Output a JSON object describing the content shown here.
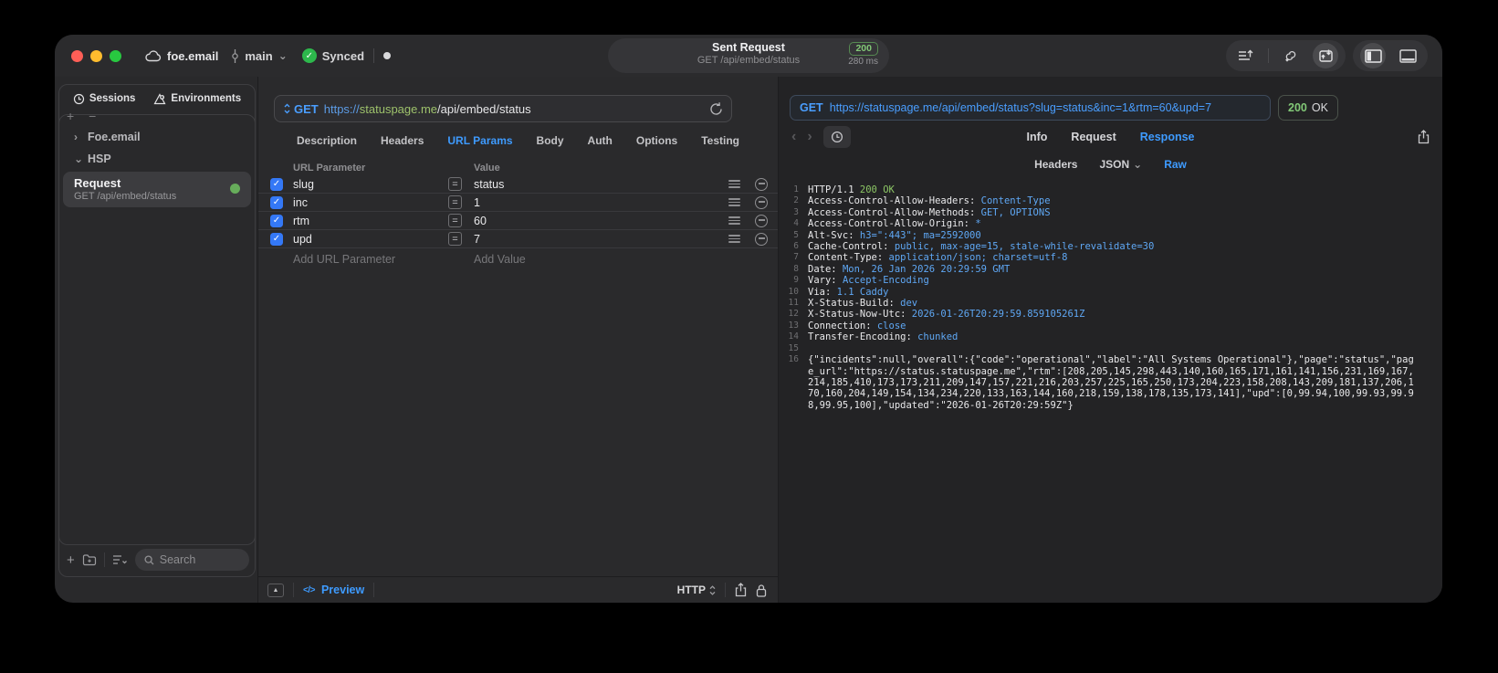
{
  "titlebar": {
    "project": "foe.email",
    "branch": "main",
    "sync_status": "Synced",
    "pill": {
      "title": "Sent Request",
      "subtitle": "GET /api/embed/status",
      "status_code": "200",
      "duration": "280 ms"
    }
  },
  "sidebar": {
    "tabs": [
      {
        "label": "Sessions"
      },
      {
        "label": "Environments"
      }
    ],
    "tree": [
      {
        "label": "Foe.email"
      },
      {
        "label": "HSP"
      }
    ],
    "request_item": {
      "title": "Request",
      "subtitle": "GET /api/embed/status"
    },
    "search_placeholder": "Search"
  },
  "request_panel": {
    "method": "GET",
    "url_scheme": "https://",
    "url_host": "statuspage.me",
    "url_path": "/api/embed/status",
    "tabs": [
      "Description",
      "Headers",
      "URL Params",
      "Body",
      "Auth",
      "Options",
      "Testing"
    ],
    "active_tab": "URL Params",
    "params_table": {
      "columns": [
        "URL Parameter",
        "Value"
      ],
      "rows": [
        {
          "name": "slug",
          "value": "status",
          "enabled": true
        },
        {
          "name": "inc",
          "value": "1",
          "enabled": true
        },
        {
          "name": "rtm",
          "value": "60",
          "enabled": true
        },
        {
          "name": "upd",
          "value": "7",
          "enabled": true
        }
      ],
      "add_name_placeholder": "Add URL Parameter",
      "add_value_placeholder": "Add Value"
    },
    "footer": {
      "preview_label": "Preview",
      "protocol": "HTTP"
    }
  },
  "response_panel": {
    "method": "GET",
    "url": "https://statuspage.me/api/embed/status?slug=status&inc=1&rtm=60&upd=7",
    "status_code": "200",
    "status_text": "OK",
    "tabs": [
      "Info",
      "Request",
      "Response"
    ],
    "active_tab": "Response",
    "subtabs": [
      "Headers",
      "JSON",
      "Raw"
    ],
    "active_subtab": "Raw",
    "body_lines": [
      {
        "n": "1",
        "parts": [
          [
            "HTTP/1.1 ",
            "p"
          ],
          [
            "200 OK",
            "g"
          ]
        ]
      },
      {
        "n": "2",
        "parts": [
          [
            "Access-Control-Allow-Headers: ",
            "p"
          ],
          [
            "Content-Type",
            "b"
          ]
        ]
      },
      {
        "n": "3",
        "parts": [
          [
            "Access-Control-Allow-Methods: ",
            "p"
          ],
          [
            "GET, OPTIONS",
            "b"
          ]
        ]
      },
      {
        "n": "4",
        "parts": [
          [
            "Access-Control-Allow-Origin: ",
            "p"
          ],
          [
            "*",
            "b"
          ]
        ]
      },
      {
        "n": "5",
        "parts": [
          [
            "Alt-Svc: ",
            "p"
          ],
          [
            "h3=\":443\"; ma=2592000",
            "b"
          ]
        ]
      },
      {
        "n": "6",
        "parts": [
          [
            "Cache-Control: ",
            "p"
          ],
          [
            "public, max-age=15, stale-while-revalidate=30",
            "b"
          ]
        ]
      },
      {
        "n": "7",
        "parts": [
          [
            "Content-Type: ",
            "p"
          ],
          [
            "application/json; charset=utf-8",
            "b"
          ]
        ]
      },
      {
        "n": "8",
        "parts": [
          [
            "Date: ",
            "p"
          ],
          [
            "Mon, 26 Jan 2026 20:29:59 GMT",
            "b"
          ]
        ]
      },
      {
        "n": "9",
        "parts": [
          [
            "Vary: ",
            "p"
          ],
          [
            "Accept-Encoding",
            "b"
          ]
        ]
      },
      {
        "n": "10",
        "parts": [
          [
            "Via: ",
            "p"
          ],
          [
            "1.1 Caddy",
            "b"
          ]
        ]
      },
      {
        "n": "11",
        "parts": [
          [
            "X-Status-Build: ",
            "p"
          ],
          [
            "dev",
            "b"
          ]
        ]
      },
      {
        "n": "12",
        "parts": [
          [
            "X-Status-Now-Utc: ",
            "p"
          ],
          [
            "2026-01-26T20:29:59.859105261Z",
            "b"
          ]
        ]
      },
      {
        "n": "13",
        "parts": [
          [
            "Connection: ",
            "p"
          ],
          [
            "close",
            "b"
          ]
        ]
      },
      {
        "n": "14",
        "parts": [
          [
            "Transfer-Encoding: ",
            "p"
          ],
          [
            "chunked",
            "b"
          ]
        ]
      },
      {
        "n": "15",
        "parts": []
      },
      {
        "n": "16",
        "parts": [
          [
            "{\"incidents\":null,\"overall\":{\"code\":\"operational\",\"label\":\"All Systems Operational\"},\"page\":\"status\",\"page_url\":\"https://status.statuspage.me\",\"rtm\":[208,205,145,298,443,140,160,165,171,161,141,156,231,169,167,214,185,410,173,173,211,209,147,157,221,216,203,257,225,165,250,173,204,223,158,208,143,209,181,137,206,170,160,204,149,154,134,234,220,133,163,144,160,218,159,138,178,135,173,141],\"upd\":[0,99.94,100,99.93,99.98,99.95,100],\"updated\":\"2026-01-26T20:29:59Z\"}",
            "p"
          ]
        ]
      }
    ]
  },
  "icons": {
    "chevron_right": "›",
    "chevron_down": "⌄",
    "plus_minus": "+ −",
    "plus": "+",
    "check": "✓",
    "equals": "=",
    "triangle_up": "▲",
    "code_tag": "</>",
    "back_arrow": "‹",
    "forward_arrow": "›"
  },
  "colors": {
    "accent_blue": "#3e9bff",
    "status_green": "#82c877",
    "checkbox_blue": "#3478f6",
    "traffic_red": "#ff5f57",
    "traffic_yellow": "#febc2e",
    "traffic_green": "#28c840"
  }
}
